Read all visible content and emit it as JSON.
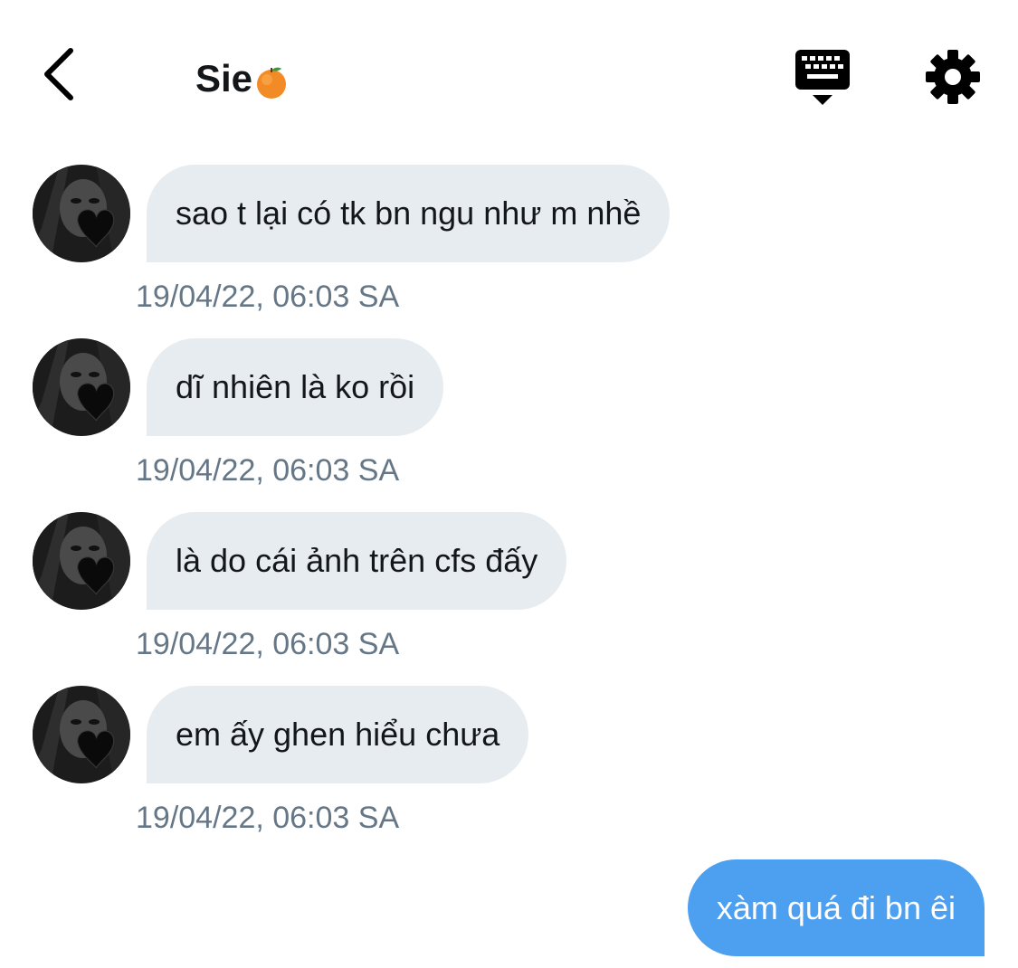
{
  "header": {
    "back_icon": "chevron-left-icon",
    "title": "Sie",
    "title_emoji": "tangerine-emoji",
    "keyboard_icon": "keyboard-icon",
    "settings_icon": "gear-icon"
  },
  "messages": [
    {
      "direction": "incoming",
      "text": "sao t lại có tk bn ngu như m nhề",
      "timestamp": "19/04/22, 06:03 SA"
    },
    {
      "direction": "incoming",
      "text": "dĩ nhiên là ko rồi",
      "timestamp": "19/04/22, 06:03 SA"
    },
    {
      "direction": "incoming",
      "text": "là do cái ảnh trên cfs đấy",
      "timestamp": "19/04/22, 06:03 SA"
    },
    {
      "direction": "incoming",
      "text": "em ấy ghen hiểu chưa",
      "timestamp": "19/04/22, 06:03 SA"
    },
    {
      "direction": "outgoing",
      "text": "xàm quá đi bn êi"
    }
  ],
  "colors": {
    "incoming_bubble": "#e6ecf0",
    "outgoing_bubble": "#4d9ff0",
    "timestamp": "#657786",
    "text": "#14171a"
  }
}
